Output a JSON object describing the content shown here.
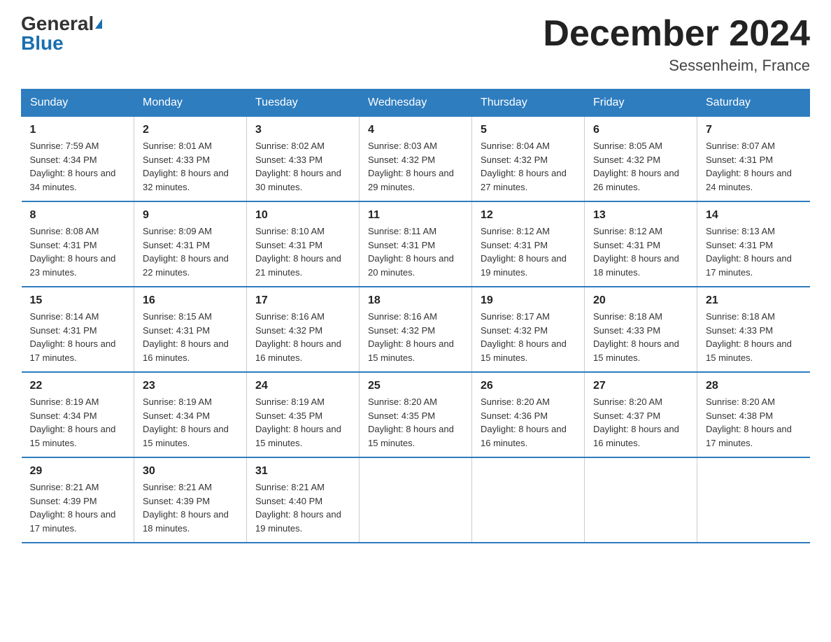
{
  "header": {
    "logo_general": "General",
    "logo_blue": "Blue",
    "month_title": "December 2024",
    "location": "Sessenheim, France"
  },
  "days_of_week": [
    "Sunday",
    "Monday",
    "Tuesday",
    "Wednesday",
    "Thursday",
    "Friday",
    "Saturday"
  ],
  "weeks": [
    [
      {
        "num": "1",
        "sunrise": "7:59 AM",
        "sunset": "4:34 PM",
        "daylight": "8 hours and 34 minutes."
      },
      {
        "num": "2",
        "sunrise": "8:01 AM",
        "sunset": "4:33 PM",
        "daylight": "8 hours and 32 minutes."
      },
      {
        "num": "3",
        "sunrise": "8:02 AM",
        "sunset": "4:33 PM",
        "daylight": "8 hours and 30 minutes."
      },
      {
        "num": "4",
        "sunrise": "8:03 AM",
        "sunset": "4:32 PM",
        "daylight": "8 hours and 29 minutes."
      },
      {
        "num": "5",
        "sunrise": "8:04 AM",
        "sunset": "4:32 PM",
        "daylight": "8 hours and 27 minutes."
      },
      {
        "num": "6",
        "sunrise": "8:05 AM",
        "sunset": "4:32 PM",
        "daylight": "8 hours and 26 minutes."
      },
      {
        "num": "7",
        "sunrise": "8:07 AM",
        "sunset": "4:31 PM",
        "daylight": "8 hours and 24 minutes."
      }
    ],
    [
      {
        "num": "8",
        "sunrise": "8:08 AM",
        "sunset": "4:31 PM",
        "daylight": "8 hours and 23 minutes."
      },
      {
        "num": "9",
        "sunrise": "8:09 AM",
        "sunset": "4:31 PM",
        "daylight": "8 hours and 22 minutes."
      },
      {
        "num": "10",
        "sunrise": "8:10 AM",
        "sunset": "4:31 PM",
        "daylight": "8 hours and 21 minutes."
      },
      {
        "num": "11",
        "sunrise": "8:11 AM",
        "sunset": "4:31 PM",
        "daylight": "8 hours and 20 minutes."
      },
      {
        "num": "12",
        "sunrise": "8:12 AM",
        "sunset": "4:31 PM",
        "daylight": "8 hours and 19 minutes."
      },
      {
        "num": "13",
        "sunrise": "8:12 AM",
        "sunset": "4:31 PM",
        "daylight": "8 hours and 18 minutes."
      },
      {
        "num": "14",
        "sunrise": "8:13 AM",
        "sunset": "4:31 PM",
        "daylight": "8 hours and 17 minutes."
      }
    ],
    [
      {
        "num": "15",
        "sunrise": "8:14 AM",
        "sunset": "4:31 PM",
        "daylight": "8 hours and 17 minutes."
      },
      {
        "num": "16",
        "sunrise": "8:15 AM",
        "sunset": "4:31 PM",
        "daylight": "8 hours and 16 minutes."
      },
      {
        "num": "17",
        "sunrise": "8:16 AM",
        "sunset": "4:32 PM",
        "daylight": "8 hours and 16 minutes."
      },
      {
        "num": "18",
        "sunrise": "8:16 AM",
        "sunset": "4:32 PM",
        "daylight": "8 hours and 15 minutes."
      },
      {
        "num": "19",
        "sunrise": "8:17 AM",
        "sunset": "4:32 PM",
        "daylight": "8 hours and 15 minutes."
      },
      {
        "num": "20",
        "sunrise": "8:18 AM",
        "sunset": "4:33 PM",
        "daylight": "8 hours and 15 minutes."
      },
      {
        "num": "21",
        "sunrise": "8:18 AM",
        "sunset": "4:33 PM",
        "daylight": "8 hours and 15 minutes."
      }
    ],
    [
      {
        "num": "22",
        "sunrise": "8:19 AM",
        "sunset": "4:34 PM",
        "daylight": "8 hours and 15 minutes."
      },
      {
        "num": "23",
        "sunrise": "8:19 AM",
        "sunset": "4:34 PM",
        "daylight": "8 hours and 15 minutes."
      },
      {
        "num": "24",
        "sunrise": "8:19 AM",
        "sunset": "4:35 PM",
        "daylight": "8 hours and 15 minutes."
      },
      {
        "num": "25",
        "sunrise": "8:20 AM",
        "sunset": "4:35 PM",
        "daylight": "8 hours and 15 minutes."
      },
      {
        "num": "26",
        "sunrise": "8:20 AM",
        "sunset": "4:36 PM",
        "daylight": "8 hours and 16 minutes."
      },
      {
        "num": "27",
        "sunrise": "8:20 AM",
        "sunset": "4:37 PM",
        "daylight": "8 hours and 16 minutes."
      },
      {
        "num": "28",
        "sunrise": "8:20 AM",
        "sunset": "4:38 PM",
        "daylight": "8 hours and 17 minutes."
      }
    ],
    [
      {
        "num": "29",
        "sunrise": "8:21 AM",
        "sunset": "4:39 PM",
        "daylight": "8 hours and 17 minutes."
      },
      {
        "num": "30",
        "sunrise": "8:21 AM",
        "sunset": "4:39 PM",
        "daylight": "8 hours and 18 minutes."
      },
      {
        "num": "31",
        "sunrise": "8:21 AM",
        "sunset": "4:40 PM",
        "daylight": "8 hours and 19 minutes."
      },
      null,
      null,
      null,
      null
    ]
  ]
}
